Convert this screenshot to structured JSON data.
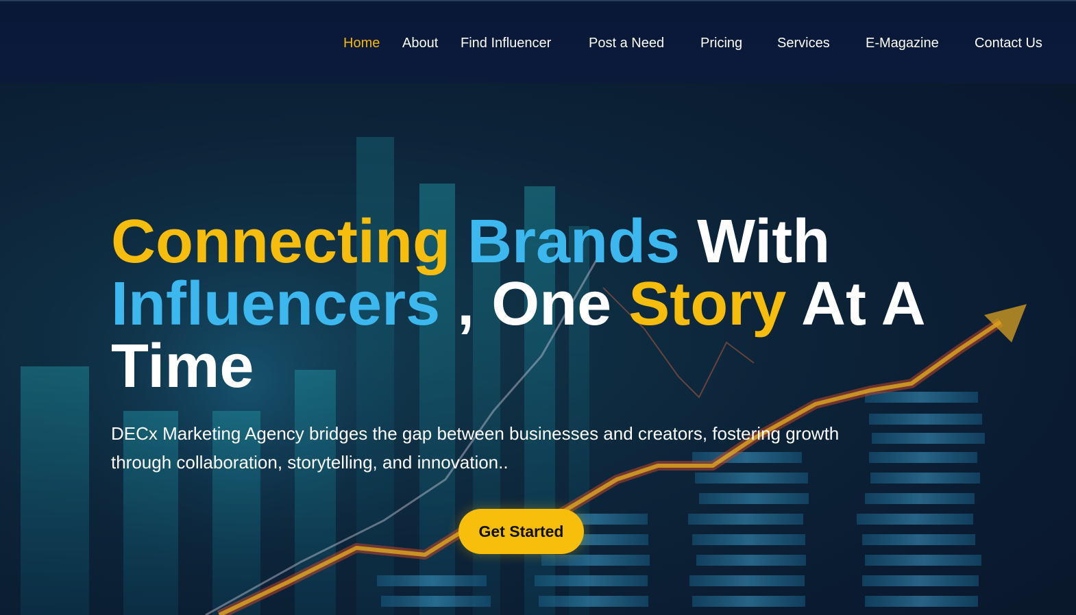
{
  "nav": {
    "items": [
      {
        "label": "Home",
        "active": true
      },
      {
        "label": "About",
        "active": false
      },
      {
        "label": "Find Influencer",
        "active": false
      },
      {
        "label": "Post a Need",
        "active": false
      },
      {
        "label": "Pricing",
        "active": false
      },
      {
        "label": "Services",
        "active": false
      },
      {
        "label": "E-Magazine",
        "active": false
      },
      {
        "label": "Contact Us",
        "active": false
      }
    ]
  },
  "hero": {
    "headline": {
      "word1": "Connecting",
      "word2": "Brands",
      "word3": "With",
      "word4": "Influencers",
      "word5": ", One",
      "word6": "Story",
      "word7": "At A",
      "word8": "Time"
    },
    "subtext": "DECx Marketing Agency bridges the gap between businesses and creators, fostering growth through collaboration, storytelling, and innovation..",
    "cta_label": "Get Started"
  },
  "colors": {
    "accent_yellow": "#f7bd0c",
    "accent_blue": "#3db8ef",
    "nav_background": "#0b1a3a"
  }
}
